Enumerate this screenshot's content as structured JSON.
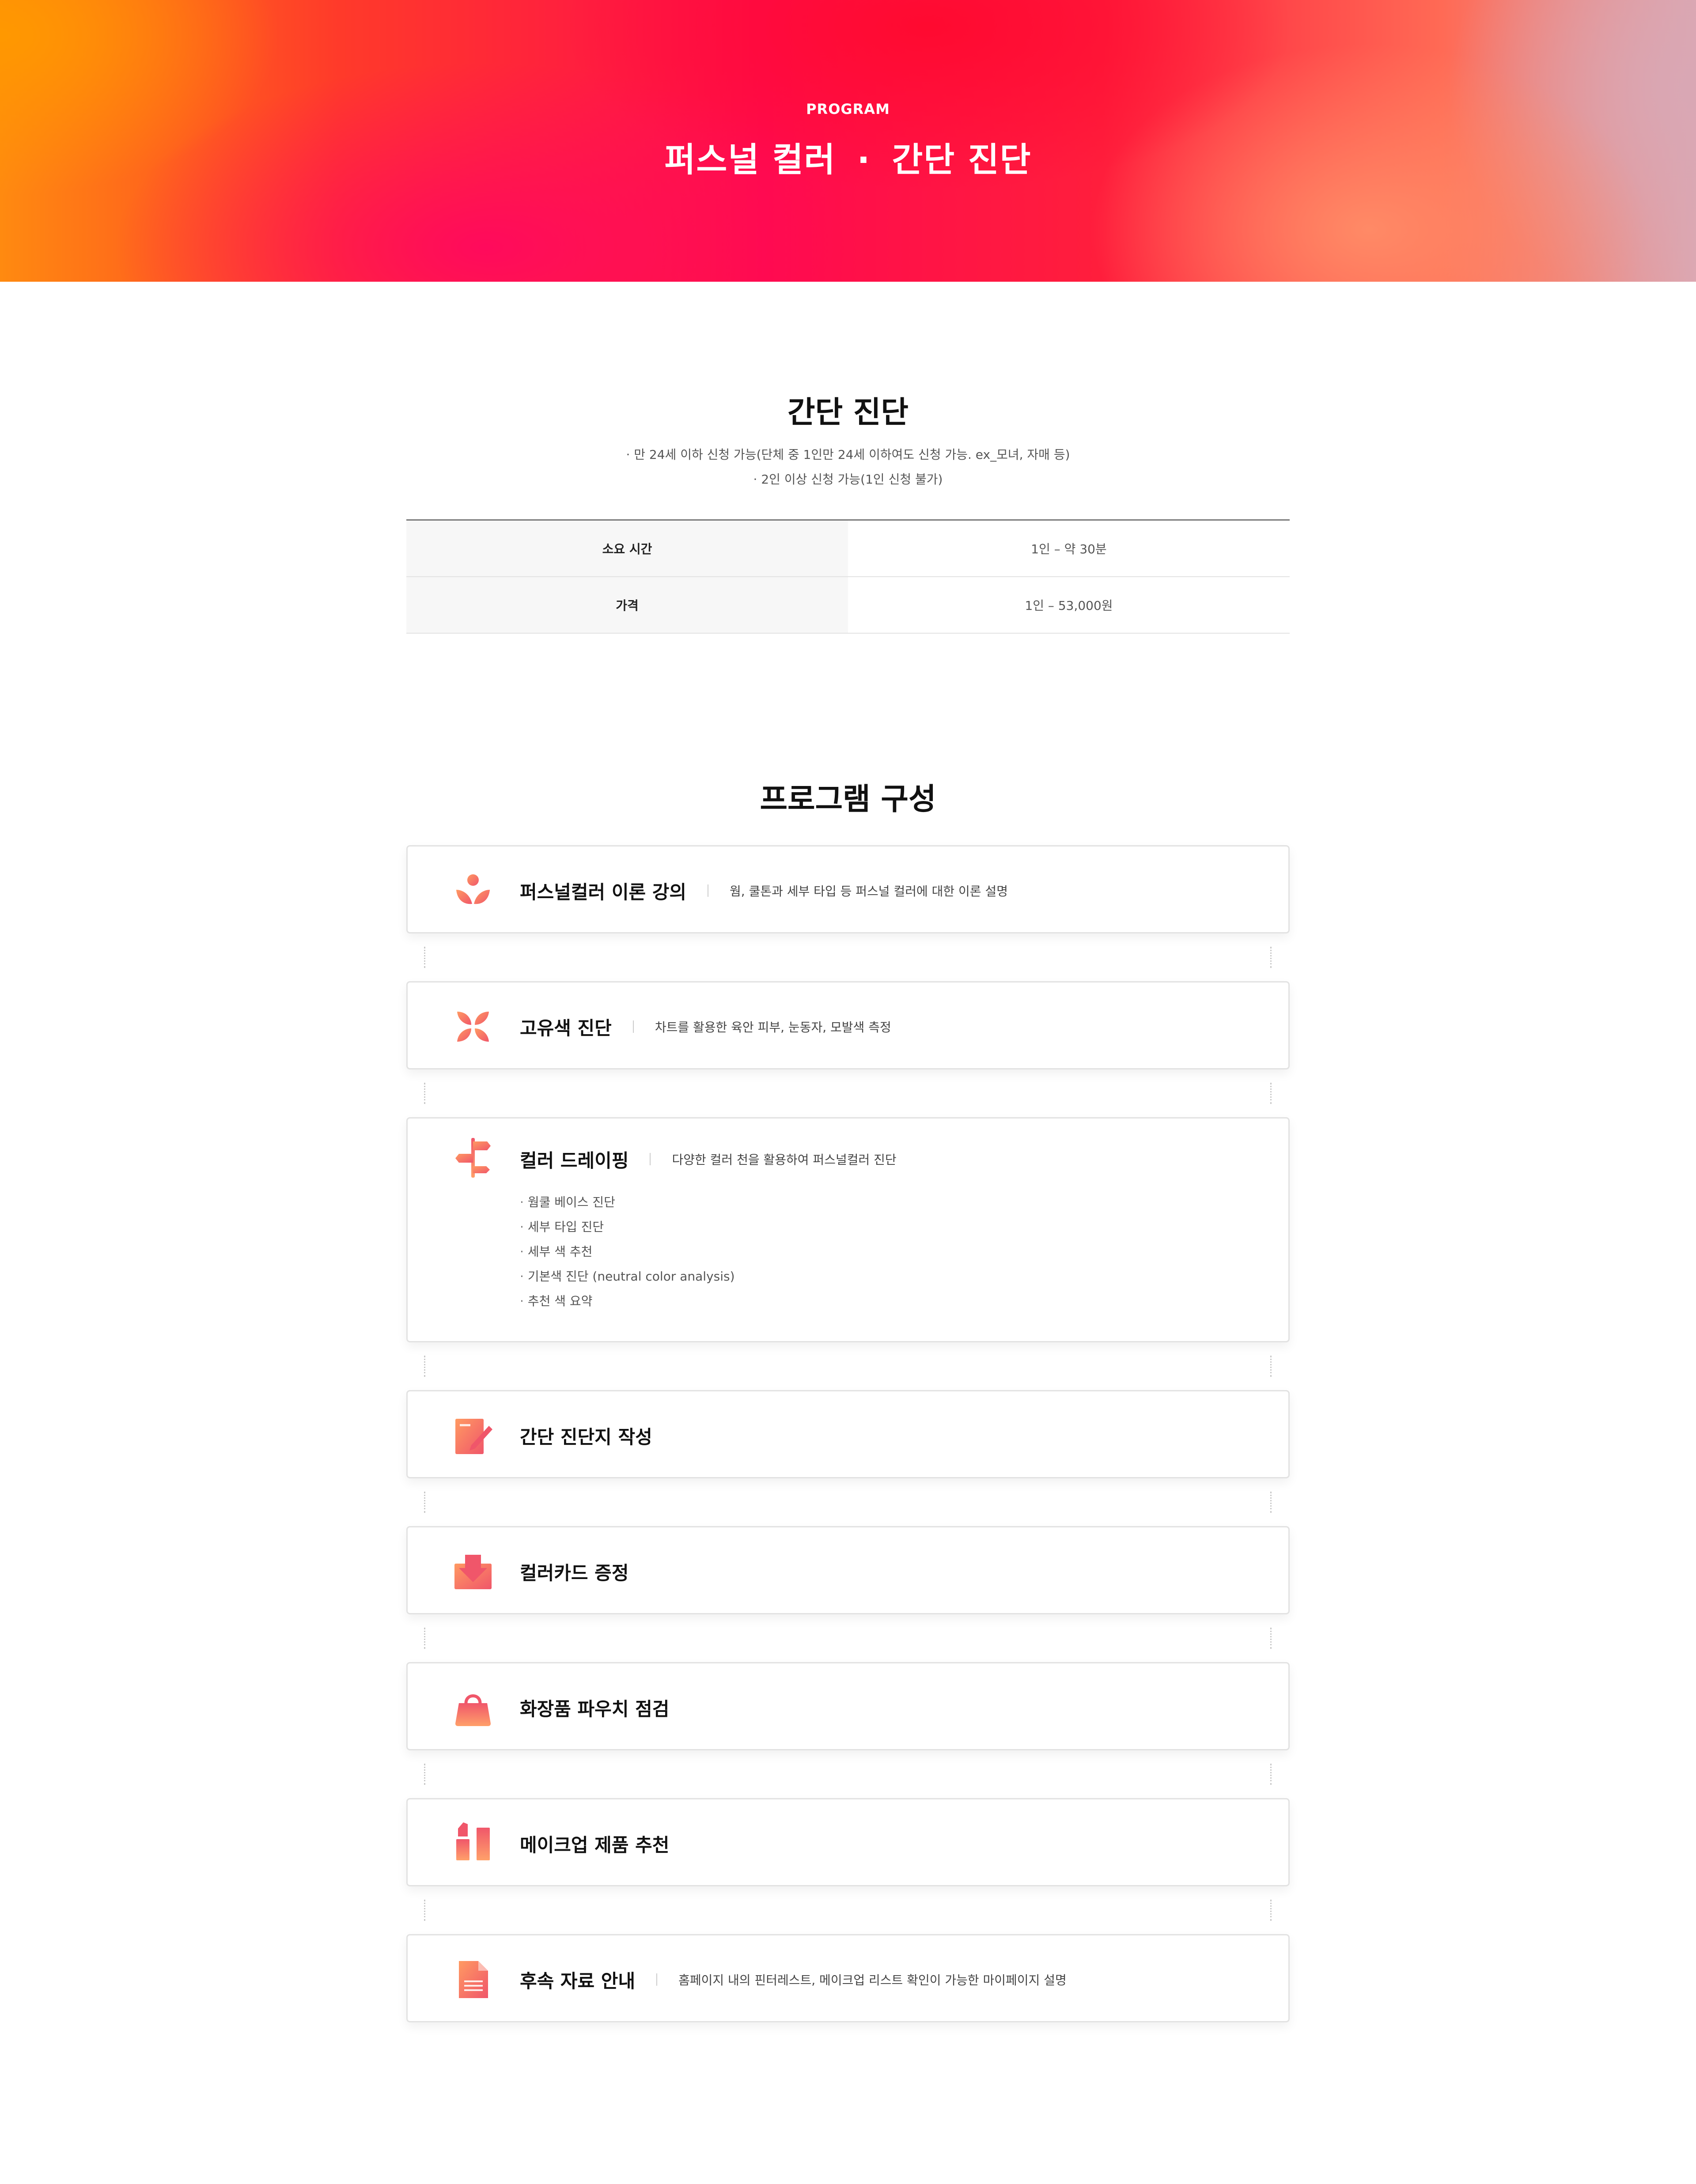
{
  "hero": {
    "eyebrow": "PROGRAM",
    "title_left": "퍼스널 컬러",
    "title_dot": "·",
    "title_right": "간단 진단"
  },
  "intro": {
    "title": "간단 진단",
    "notes": [
      "· 만 24세 이하 신청 가능(단체 중 1인만 24세 이하여도 신청 가능. ex_모녀, 자매 등)",
      "· 2인 이상 신청 가능(1인 신청 불가)"
    ],
    "table": [
      {
        "label": "소요 시간",
        "value": "1인 – 약 30분"
      },
      {
        "label": "가격",
        "value": "1인 – 53,000원"
      }
    ]
  },
  "program": {
    "title": "프로그램 구성",
    "items": [
      {
        "name": "퍼스널컬러 이론 강의",
        "desc": "웜, 쿨톤과 세부 타입 등 퍼스널 컬러에 대한 이론 설명",
        "icon": "flower-sprout-icon"
      },
      {
        "name": "고유색 진단",
        "desc": "차트를 활용한 육안 피부, 눈동자, 모발색 측정",
        "icon": "butterfly-petal-icon"
      },
      {
        "name": "컬러 드레이핑",
        "desc": "다양한 컬러 천을 활용하여 퍼스널컬러 진단",
        "icon": "signpost-icon",
        "bullets": [
          "웜쿨 베이스 진단",
          "세부 타입 진단",
          "세부 색 추천",
          "기본색 진단 (neutral color analysis)",
          "추천 색 요약"
        ]
      },
      {
        "name": "간단 진단지 작성",
        "icon": "notepad-pencil-icon"
      },
      {
        "name": "컬러카드 증정",
        "icon": "envelope-download-icon"
      },
      {
        "name": "화장품 파우치 점검",
        "icon": "handbag-icon"
      },
      {
        "name": "메이크업 제품 추천",
        "icon": "lipstick-icon"
      },
      {
        "name": "후속 자료 안내",
        "desc": "홈페이지 내의 핀터레스트, 메이크업 리스트 확인이 가능한 마이페이지 설명",
        "icon": "document-icon"
      }
    ]
  },
  "colors": {
    "accent_start": "#ff9a62",
    "accent_end": "#f0566a",
    "hero_mid": "#ff0a4e"
  }
}
